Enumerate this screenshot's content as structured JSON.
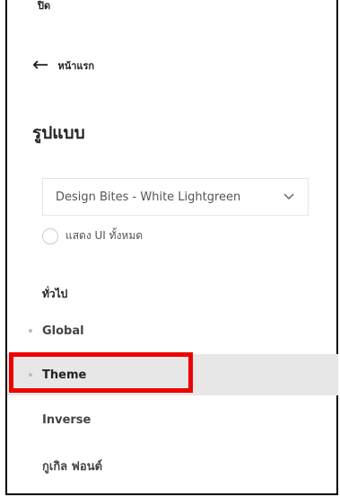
{
  "header": {
    "close_label": "ปิด"
  },
  "back": {
    "label": "หน้าแรก"
  },
  "panel": {
    "title": "รูปแบบ"
  },
  "select": {
    "value": "Design Bites - White Lightgreen"
  },
  "toggle": {
    "label": "แสดง UI ทั้งหมด"
  },
  "section": {
    "heading": "ทั่วไป"
  },
  "nav": {
    "items": [
      {
        "label": "Global",
        "active": false
      },
      {
        "label": "Theme",
        "active": true
      },
      {
        "label": "Inverse",
        "active": false
      },
      {
        "label": "กูเกิล ฟอนต์",
        "active": false
      }
    ]
  },
  "colors": {
    "highlight": "#ee0000",
    "active_bg": "#e7e7e7"
  },
  "icons": {
    "back": "arrow-left-icon",
    "select": "chevron-down-icon"
  }
}
